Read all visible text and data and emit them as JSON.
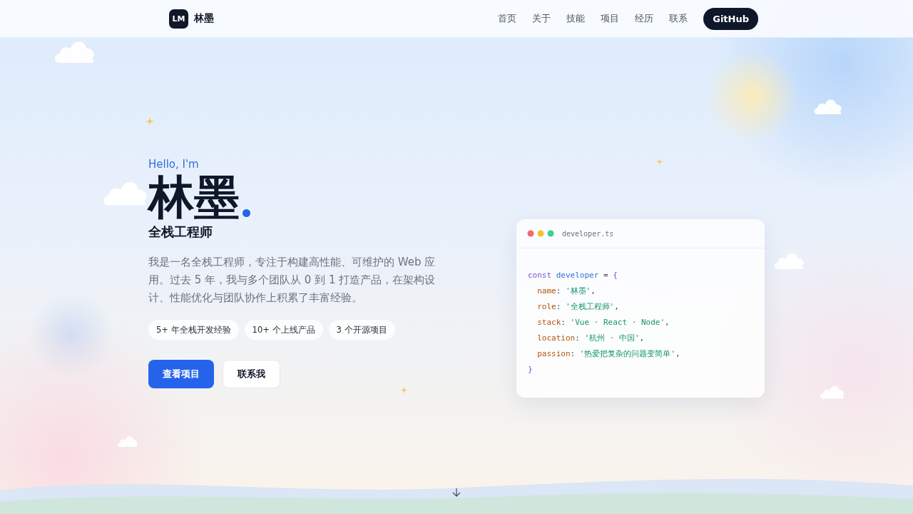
{
  "nav": {
    "logo_mark": "LM",
    "logo_text": "林墨",
    "links": [
      {
        "label": "首页"
      },
      {
        "label": "关于"
      },
      {
        "label": "技能"
      },
      {
        "label": "项目"
      },
      {
        "label": "经历"
      },
      {
        "label": "联系"
      }
    ],
    "cta": "GitHub"
  },
  "hero": {
    "greeting": "Hello, I'm",
    "name": "林墨",
    "role": "全栈工程师",
    "intro": "我是一名全栈工程师，专注于构建高性能、可维护的 Web 应用。过去 5 年，我与多个团队从 0 到 1 打造产品，在架构设计、性能优化与团队协作上积累了丰富经验。",
    "tags": [
      "5+ 年全栈开发经验",
      "10+ 个上线产品",
      "3 个开源项目"
    ],
    "buttons": [
      {
        "label": "查看项目",
        "kind": "primary"
      },
      {
        "label": "联系我",
        "kind": "secondary"
      }
    ]
  },
  "code_card": {
    "filename": "developer.ts",
    "lines": [
      {
        "tokens": [
          {
            "kind": "keyword",
            "text": "const "
          },
          {
            "kind": "var",
            "text": "developer"
          },
          {
            "kind": "punct",
            "text": " = "
          },
          {
            "kind": "brace",
            "text": "{"
          }
        ]
      },
      {
        "tokens": [
          {
            "kind": "key",
            "text": "  name"
          },
          {
            "kind": "punct",
            "text": ": "
          },
          {
            "kind": "string",
            "text": "'林墨'"
          },
          {
            "kind": "punct",
            "text": ","
          }
        ]
      },
      {
        "tokens": [
          {
            "kind": "key",
            "text": "  role"
          },
          {
            "kind": "punct",
            "text": ": "
          },
          {
            "kind": "string",
            "text": "'全栈工程师'"
          },
          {
            "kind": "punct",
            "text": ","
          }
        ]
      },
      {
        "tokens": [
          {
            "kind": "key",
            "text": "  stack"
          },
          {
            "kind": "punct",
            "text": ": "
          },
          {
            "kind": "string",
            "text": "'Vue · React · Node'"
          },
          {
            "kind": "punct",
            "text": ","
          }
        ]
      },
      {
        "tokens": [
          {
            "kind": "key",
            "text": "  location"
          },
          {
            "kind": "punct",
            "text": ": "
          },
          {
            "kind": "string",
            "text": "'杭州 · 中国'"
          },
          {
            "kind": "punct",
            "text": ","
          }
        ]
      },
      {
        "tokens": [
          {
            "kind": "key",
            "text": "  passion"
          },
          {
            "kind": "punct",
            "text": ": "
          },
          {
            "kind": "string",
            "text": "'热爱把复杂的问题变简单'"
          },
          {
            "kind": "punct",
            "text": ","
          }
        ]
      },
      {
        "tokens": [
          {
            "kind": "brace",
            "text": "}"
          }
        ]
      }
    ]
  }
}
